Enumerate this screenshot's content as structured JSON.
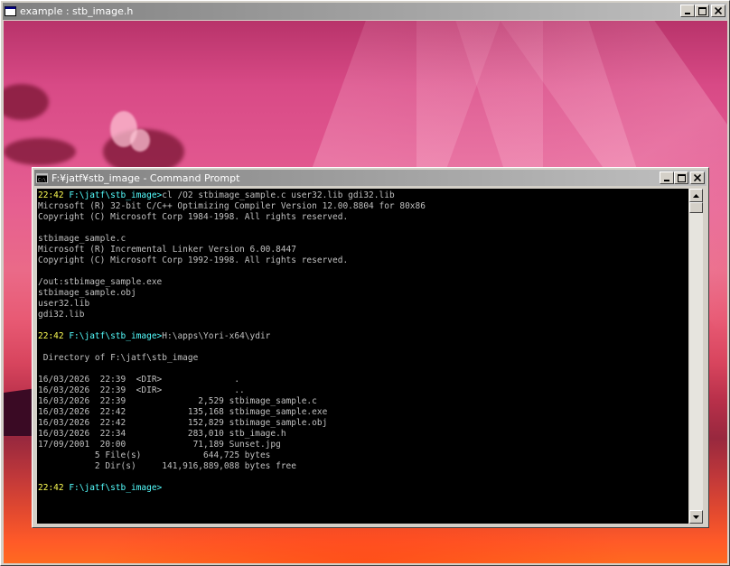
{
  "outer_window": {
    "title": "example : stb_image.h",
    "buttons": {
      "minimize": "minimize",
      "maximize": "maximize",
      "close": "close"
    }
  },
  "console_window": {
    "title": "F:¥jatf¥stb_image - Command Prompt",
    "buttons": {
      "minimize": "minimize",
      "maximize": "maximize",
      "close": "close"
    },
    "lines": [
      {
        "time": "22:42",
        "path": "F:\\jatf\\stb_image>",
        "text": "cl /O2 stbimage_sample.c user32.lib gdi32.lib"
      },
      {
        "text": "Microsoft (R) 32-bit C/C++ Optimizing Compiler Version 12.00.8804 for 80x86"
      },
      {
        "text": "Copyright (C) Microsoft Corp 1984-1998. All rights reserved."
      },
      {
        "text": ""
      },
      {
        "text": "stbimage_sample.c"
      },
      {
        "text": "Microsoft (R) Incremental Linker Version 6.00.8447"
      },
      {
        "text": "Copyright (C) Microsoft Corp 1992-1998. All rights reserved."
      },
      {
        "text": ""
      },
      {
        "text": "/out:stbimage_sample.exe"
      },
      {
        "text": "stbimage_sample.obj"
      },
      {
        "text": "user32.lib"
      },
      {
        "text": "gdi32.lib"
      },
      {
        "text": ""
      },
      {
        "time": "22:42",
        "path": "F:\\jatf\\stb_image>",
        "text": "H:\\apps\\Yori-x64\\ydir"
      },
      {
        "text": ""
      },
      {
        "text": " Directory of F:\\jatf\\stb_image"
      },
      {
        "text": ""
      },
      {
        "text": "16/03/2026  22:39  <DIR>              ."
      },
      {
        "text": "16/03/2026  22:39  <DIR>              .."
      },
      {
        "text": "16/03/2026  22:39              2,529 stbimage_sample.c"
      },
      {
        "text": "16/03/2026  22:42            135,168 stbimage_sample.exe"
      },
      {
        "text": "16/03/2026  22:42            152,829 stbimage_sample.obj"
      },
      {
        "text": "16/03/2026  22:34            283,010 stb_image.h"
      },
      {
        "text": "17/09/2001  20:00             71,189 Sunset.jpg"
      },
      {
        "text": "           5 File(s)            644,725 bytes"
      },
      {
        "text": "           2 Dir(s)     141,916,889,088 bytes free"
      },
      {
        "text": ""
      },
      {
        "time": "22:42",
        "path": "F:\\jatf\\stb_image>",
        "text": ""
      }
    ]
  },
  "scrollbar": {
    "up_arrow": "scroll-up",
    "down_arrow": "scroll-down"
  }
}
